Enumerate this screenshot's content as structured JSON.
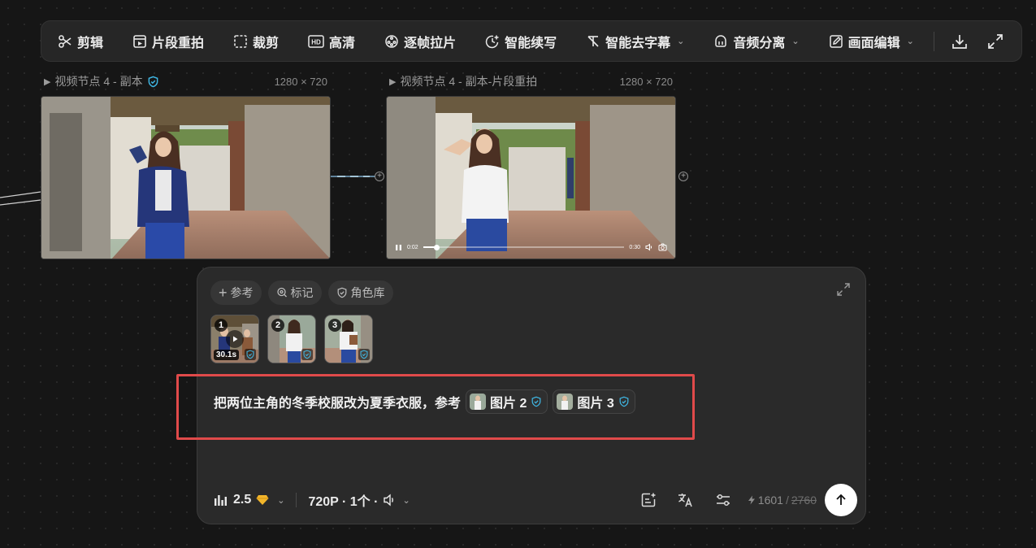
{
  "toolbar": {
    "items": [
      {
        "label": "剪辑",
        "icon": "scissors-icon"
      },
      {
        "label": "片段重拍",
        "icon": "clip-reshoot-icon"
      },
      {
        "label": "裁剪",
        "icon": "crop-icon"
      },
      {
        "label": "高清",
        "icon": "hd-icon"
      },
      {
        "label": "逐帧拉片",
        "icon": "frame-analysis-icon"
      },
      {
        "label": "智能续写",
        "icon": "smart-continue-icon"
      },
      {
        "label": "智能去字幕",
        "icon": "remove-subtitle-icon"
      },
      {
        "label": "音频分离",
        "icon": "audio-separate-icon"
      },
      {
        "label": "画面编辑",
        "icon": "edit-icon"
      }
    ],
    "download_icon": "download-icon",
    "fullscreen_icon": "fullscreen-icon"
  },
  "nodes": [
    {
      "title": "视频节点 4 - 副本",
      "dims": "1280 × 720",
      "verified": true
    },
    {
      "title": "视频节点 4 - 副本-片段重拍",
      "dims": "1280 × 720",
      "verified": false,
      "player": {
        "current": "0:02",
        "duration": "0:30",
        "progress": 0.07
      }
    }
  ],
  "panel": {
    "chips": [
      "参考",
      "标记",
      "角色库"
    ],
    "refs": [
      {
        "num": "1",
        "duration": "30.1s",
        "is_video": true
      },
      {
        "num": "2"
      },
      {
        "num": "3"
      }
    ],
    "prompt_text": "把两位主角的冬季校服改为夏季衣服，参考",
    "mentions": [
      "图片 2",
      "图片 3"
    ],
    "model": "2.5",
    "settings": "720P · 1个 ·",
    "credits_now": "1601",
    "credits_sep": "/",
    "credits_old": "2760"
  },
  "colors": {
    "accent_cyan": "#3fb8e6",
    "highlight_red": "#e04a4a"
  }
}
